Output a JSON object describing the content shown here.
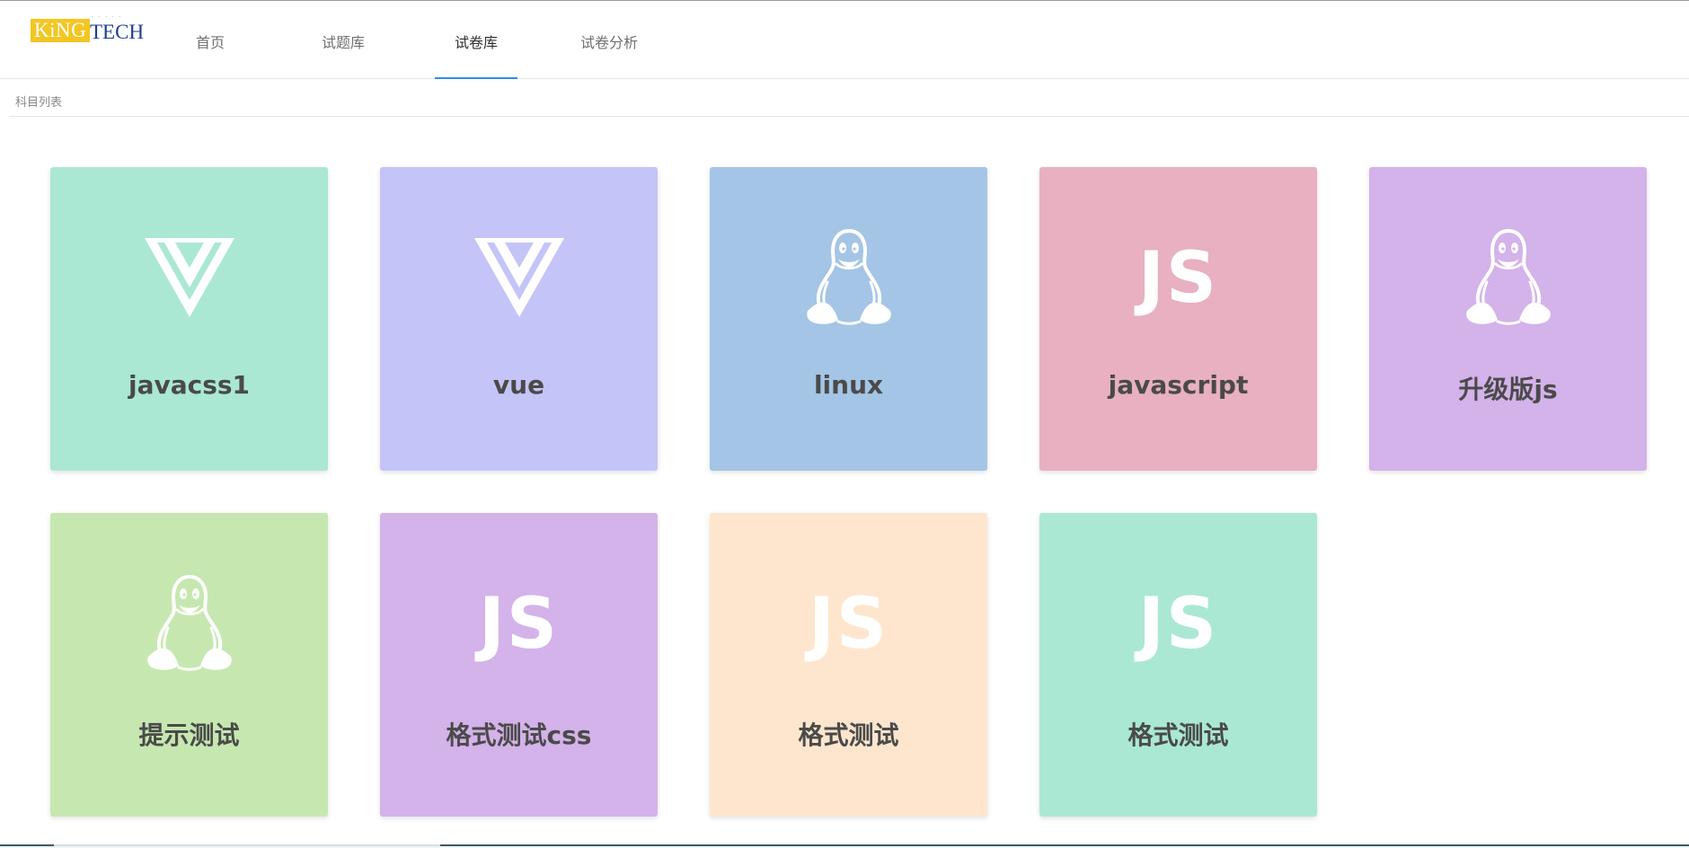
{
  "logo": {
    "text_left": "KiNG",
    "text_right": "TECH"
  },
  "nav": {
    "items": [
      {
        "label": "首页",
        "active": false
      },
      {
        "label": "试题库",
        "active": false
      },
      {
        "label": "试卷库",
        "active": true
      },
      {
        "label": "试卷分析",
        "active": false
      }
    ]
  },
  "section": {
    "title": "科目列表"
  },
  "cards": [
    {
      "label": "javacss1",
      "icon": "vue-icon",
      "color": "#aae8d4"
    },
    {
      "label": "vue",
      "icon": "vue-icon",
      "color": "#c4c4f8"
    },
    {
      "label": "linux",
      "icon": "linux-penguin-icon",
      "color": "#a4c5e5"
    },
    {
      "label": "javascript",
      "icon": "js-icon",
      "icon_text": "JS",
      "color": "#e8b0c0"
    },
    {
      "label": "升级版js",
      "icon": "linux-penguin-icon",
      "color": "#d4b2ea"
    },
    {
      "label": "提示测试",
      "icon": "linux-penguin-icon",
      "color": "#c6e8b0"
    },
    {
      "label": "格式测试css",
      "icon": "js-icon",
      "icon_text": "JS",
      "color": "#d4b2ea"
    },
    {
      "label": "格式测试",
      "icon": "js-icon",
      "icon_text": "JS",
      "color": "#fee6ce"
    },
    {
      "label": "格式测试",
      "icon": "js-icon",
      "icon_text": "JS",
      "color": "#aae8d4"
    }
  ]
}
